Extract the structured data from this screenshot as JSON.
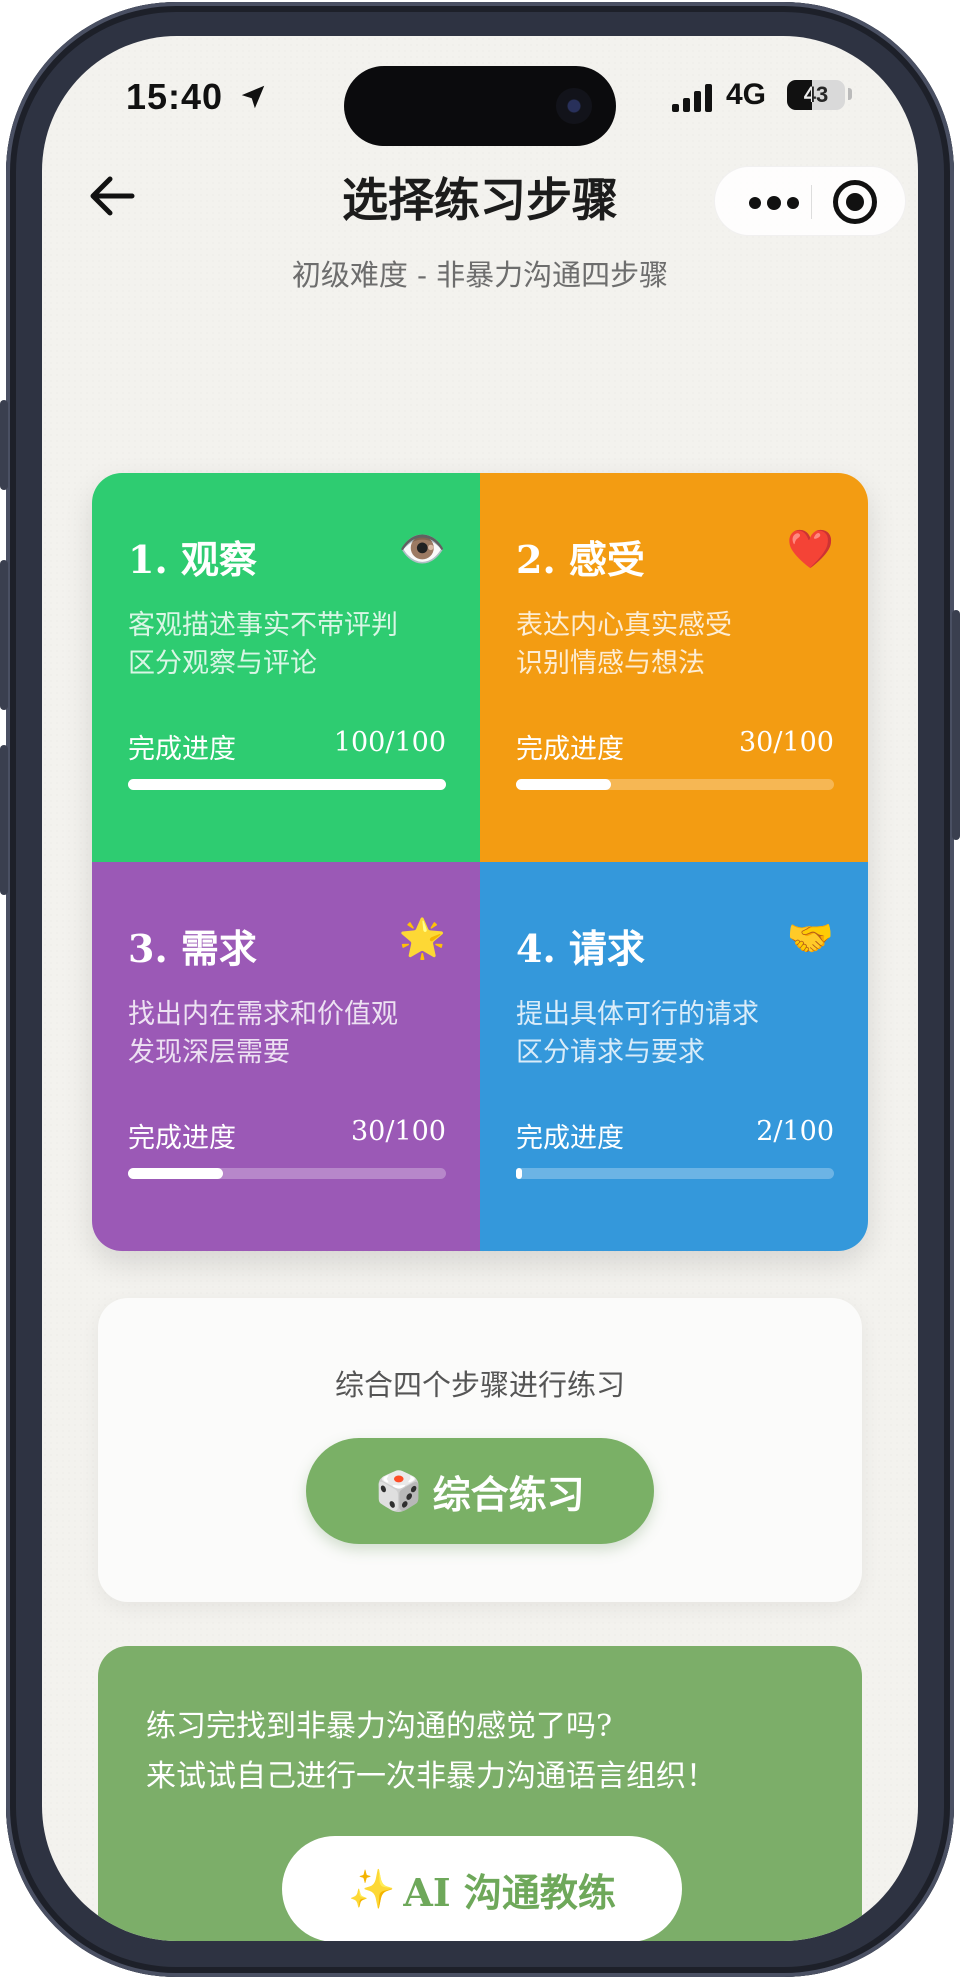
{
  "status_bar": {
    "time": "15:40",
    "network": "4G",
    "battery": "43",
    "battery_level": 0.43
  },
  "nav": {
    "title": "选择练习步骤",
    "subtitle": "初级难度 - 非暴力沟通四步骤"
  },
  "steps": [
    {
      "title": "1. 观察",
      "emoji": "👁️",
      "desc1": "客观描述事实不带评判",
      "desc2": "区分观察与评论",
      "progress_label": "完成进度",
      "progress_text": "100/100",
      "progress": 1.0,
      "color": "#2ecc71"
    },
    {
      "title": "2. 感受",
      "emoji": "❤️",
      "desc1": "表达内心真实感受",
      "desc2": "识别情感与想法",
      "progress_label": "完成进度",
      "progress_text": "30/100",
      "progress": 0.3,
      "color": "#f39c12"
    },
    {
      "title": "3. 需求",
      "emoji": "🌟",
      "desc1": "找出内在需求和价值观",
      "desc2": "发现深层需要",
      "progress_label": "完成进度",
      "progress_text": "30/100",
      "progress": 0.3,
      "color": "#9b59b6"
    },
    {
      "title": "4. 请求",
      "emoji": "🤝",
      "desc1": "提出具体可行的请求",
      "desc2": "区分请求与要求",
      "progress_label": "完成进度",
      "progress_text": "2/100",
      "progress": 0.02,
      "color": "#3498db"
    }
  ],
  "practice": {
    "text": "综合四个步骤进行练习",
    "button_emoji": "🎲",
    "button_label": "综合练习"
  },
  "ai": {
    "line1": "练习完找到非暴力沟通的感觉了吗?",
    "line2": "来试试自己进行一次非暴力沟通语言组织！",
    "button_emoji": "✨",
    "button_label": "AI 沟通教练"
  }
}
